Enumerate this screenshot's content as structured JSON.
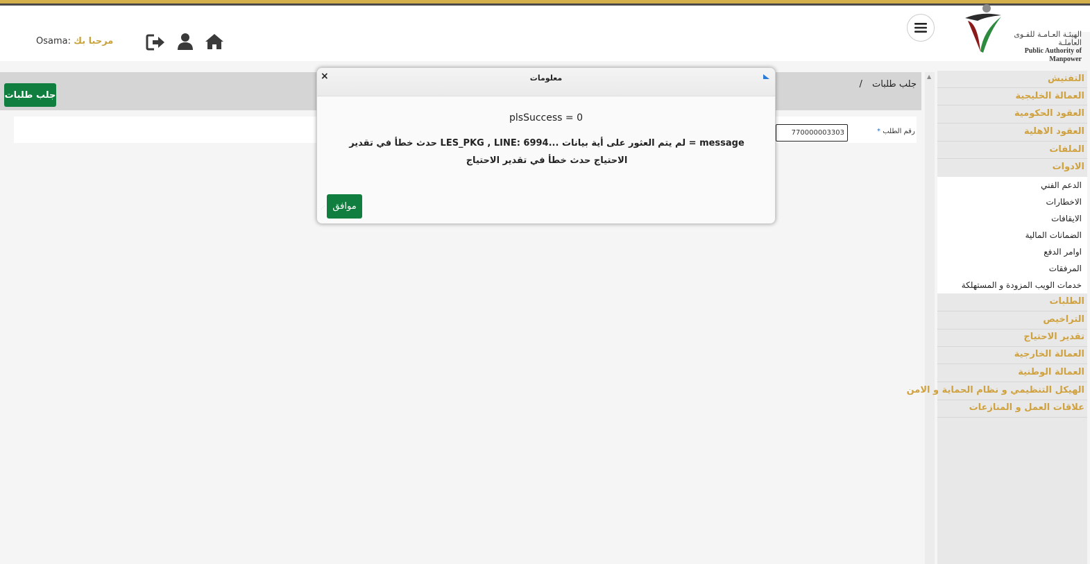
{
  "header": {
    "logo_arabic": "الهيئـة العـامـة للقـوى العاملـة",
    "logo_english": "Public Authority of Manpower",
    "welcome_greeting": "مرحبا بك",
    "welcome_name": "Osama:",
    "icons": [
      "logout-icon",
      "user-icon",
      "home-icon",
      "menu-icon"
    ]
  },
  "page": {
    "breadcrumb": "جلب طلبات",
    "breadcrumb_sep": "/",
    "fetch_button": "جلب طلبات",
    "form": {
      "required_mark": "*",
      "request_number_label": "رقم الطلب",
      "request_number_value": "770000003303"
    }
  },
  "sidebar": {
    "items_top": [
      "التفتيش",
      "العمالة الخليجية",
      "العقود الحكومية",
      "العقود الاهلية",
      "الملفات",
      "الادوات"
    ],
    "tools_sub": [
      "الدعم الفني",
      "الاخطارات",
      "الايقافات",
      "الضمانات المالية",
      "اوامر الدفع",
      "المرفقات",
      "خدمات الويب المزودة و المستهلكة"
    ],
    "items_bottom": [
      "الطلبات",
      "التراخيص",
      "تقدير الاحتياج",
      "العمالة الخارجية",
      "العمالة الوطنية",
      "الهيكل التنظيمي و نظام الحماية و الامن",
      "علاقات العمل و المنازعات"
    ]
  },
  "dialog": {
    "title": "معلومات",
    "close": "×",
    "line1": "plsSuccess = 0",
    "line2": "message = لم يتم العثور على أية بيانات ...LES_PKG , LINE: 6994 حدث خطأ في تقدير الاحتياج حدث خطأ في تقدير الاحتياج",
    "ok_button": "موافق"
  },
  "colors": {
    "accent_gold": "#d0a23f",
    "button_green": "#0f7e3e",
    "bar_gray": "#d5d5d5",
    "sidebar_gray": "#e8e8e8"
  }
}
